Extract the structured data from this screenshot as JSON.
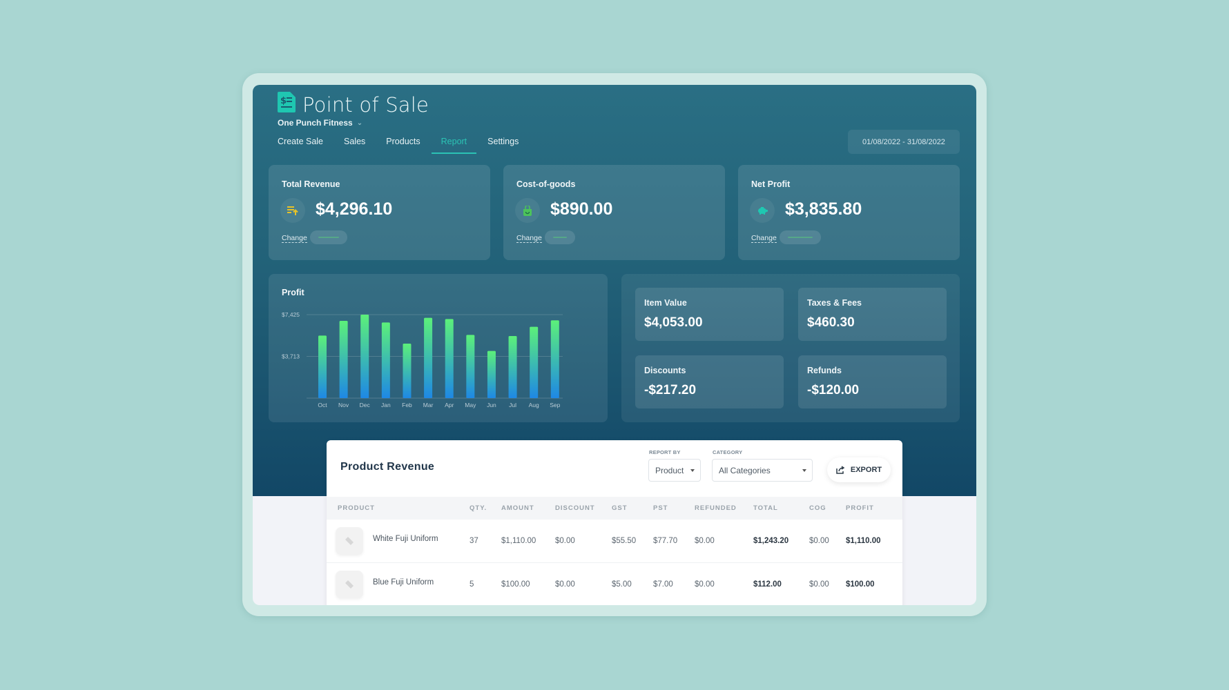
{
  "app": {
    "title": "Point of Sale",
    "organization": "One Punch Fitness",
    "accent_color": "#2bc3b4"
  },
  "nav": {
    "items": [
      {
        "label": "Create Sale",
        "active": false
      },
      {
        "label": "Sales",
        "active": false
      },
      {
        "label": "Products",
        "active": false
      },
      {
        "label": "Report",
        "active": true
      },
      {
        "label": "Settings",
        "active": false
      }
    ]
  },
  "date_range": "01/08/2022 - 31/08/2022",
  "kpis": [
    {
      "label": "Total Revenue",
      "value": "$4,296.10",
      "icon": "revenue-list-icon",
      "icon_color": "#e6c229",
      "change_label": "Change"
    },
    {
      "label": "Cost-of-goods",
      "value": "$890.00",
      "icon": "shopping-bag-icon",
      "icon_color": "#4cc35a",
      "change_label": "Change"
    },
    {
      "label": "Net Profit",
      "value": "$3,835.80",
      "icon": "piggy-bank-icon",
      "icon_color": "#1fc7b1",
      "change_label": "Change"
    }
  ],
  "metrics": [
    {
      "label": "Item Value",
      "value": "$4,053.00"
    },
    {
      "label": "Taxes & Fees",
      "value": "$460.30"
    },
    {
      "label": "Discounts",
      "value": "-$217.20"
    },
    {
      "label": "Refunds",
      "value": "-$120.00"
    }
  ],
  "chart_data": {
    "type": "bar",
    "title": "Profit",
    "categories": [
      "Oct",
      "Nov",
      "Dec",
      "Jan",
      "Feb",
      "Mar",
      "Apr",
      "May",
      "Jun",
      "Jul",
      "Aug",
      "Sep"
    ],
    "values": [
      5560,
      6870,
      7425,
      6730,
      4850,
      7140,
      7035,
      5625,
      4195,
      5525,
      6340,
      6915
    ],
    "yticks": [
      3713,
      7425
    ],
    "ytick_labels": [
      "$3,713",
      "$7,425"
    ],
    "ylim": [
      0,
      7425
    ],
    "xlabel": "",
    "ylabel": "",
    "grid": true,
    "gradient": [
      "#1e88e5",
      "#5cf07a"
    ]
  },
  "product_revenue": {
    "title": "Product Revenue",
    "report_by": {
      "label": "REPORT BY",
      "value": "Product"
    },
    "category": {
      "label": "CATEGORY",
      "value": "All Categories"
    },
    "export_label": "EXPORT",
    "columns": [
      "PRODUCT",
      "QTY.",
      "AMOUNT",
      "DISCOUNT",
      "GST",
      "PST",
      "REFUNDED",
      "TOTAL",
      "COG",
      "PROFIT"
    ],
    "rows": [
      {
        "product": "White Fuji Uniform",
        "qty": "37",
        "amount": "$1,110.00",
        "discount": "$0.00",
        "gst": "$55.50",
        "pst": "$77.70",
        "refunded": "$0.00",
        "total": "$1,243.20",
        "cog": "$0.00",
        "profit": "$1,110.00"
      },
      {
        "product": "Blue Fuji Uniform",
        "qty": "5",
        "amount": "$100.00",
        "discount": "$0.00",
        "gst": "$5.00",
        "pst": "$7.00",
        "refunded": "$0.00",
        "total": "$112.00",
        "cog": "$0.00",
        "profit": "$100.00"
      }
    ]
  }
}
